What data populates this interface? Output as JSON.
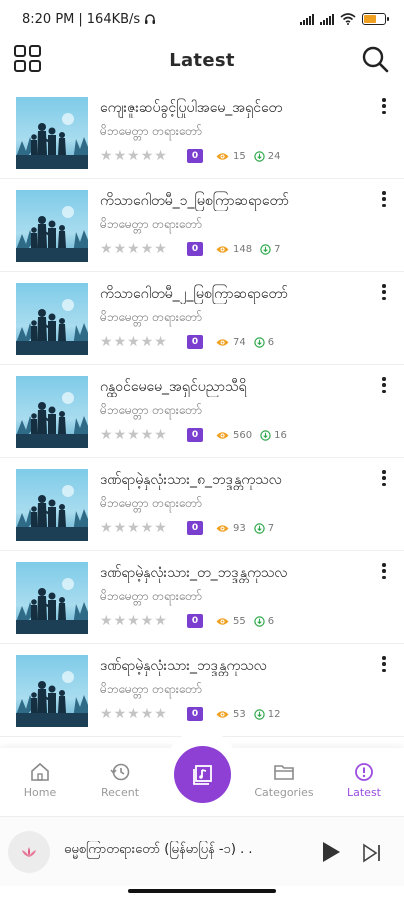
{
  "status_bar": {
    "time": "8:20 PM",
    "net_speed": "164KB/s",
    "battery_level": 0.6
  },
  "app_bar": {
    "title": "Latest",
    "left_icon": "grid-menu-icon",
    "right_icon": "search-icon"
  },
  "items": [
    {
      "title": "ကျေးဇူးဆပ်ခွင့်ပြုပါအမေ_အရှင်တေ",
      "author": "မိဘမေတ္တာ တရားတော်",
      "rating": 0,
      "badge": "0",
      "views": "15",
      "downloads": "24"
    },
    {
      "title": "ကိသာဂေါတမီ_၁_မြစကြာဆရာတော်",
      "author": "မိဘမေတ္တာ တရားတော်",
      "rating": 0,
      "badge": "0",
      "views": "148",
      "downloads": "7"
    },
    {
      "title": "ကိသာဂေါတမီ_၂_မြစကြာဆရာတော်",
      "author": "မိဘမေတ္တာ တရားတော်",
      "rating": 0,
      "badge": "0",
      "views": "74",
      "downloads": "6"
    },
    {
      "title": "ဂန္ထဝင်မေမေ_အရှင်ပညာသီရိ",
      "author": "မိဘမေတ္တာ တရားတော်",
      "rating": 0,
      "badge": "0",
      "views": "560",
      "downloads": "16"
    },
    {
      "title": "ဒဏ်ရာမဲ့နှလုံးသား_၈_ဘဒ္ဒန္တကုသလ",
      "author": "မိဘမေတ္တာ တရားတော်",
      "rating": 0,
      "badge": "0",
      "views": "93",
      "downloads": "7"
    },
    {
      "title": "ဒဏ်ရာမဲ့နှလုံးသား_တ_ဘဒ္ဒန္တကုသလ",
      "author": "မိဘမေတ္တာ တရားတော်",
      "rating": 0,
      "badge": "0",
      "views": "55",
      "downloads": "6"
    },
    {
      "title": "ဒဏ်ရာမဲ့နှလုံးသား_ဘဒ္ဒန္တကုသလ",
      "author": "မိဘမေတ္တာ တရားတော်",
      "rating": 0,
      "badge": "0",
      "views": "53",
      "downloads": "12"
    }
  ],
  "bottom_nav": {
    "items": [
      {
        "label": "Home",
        "icon": "home-icon",
        "active": false
      },
      {
        "label": "Recent",
        "icon": "history-icon",
        "active": false
      },
      {
        "label": "Categories",
        "icon": "folder-icon",
        "active": false
      },
      {
        "label": "Latest",
        "icon": "latest-icon",
        "active": true
      }
    ],
    "center_icon": "now-playing-icon"
  },
  "player": {
    "now_playing": "ဓမ္မစကြာတရားတော် (မြန်မာပြန် -၁) . ."
  },
  "colors": {
    "accent": "#8e3fd4",
    "active_nav": "#9b4de0",
    "views_icon": "#f0a020",
    "downloads_icon": "#2ea84a"
  }
}
